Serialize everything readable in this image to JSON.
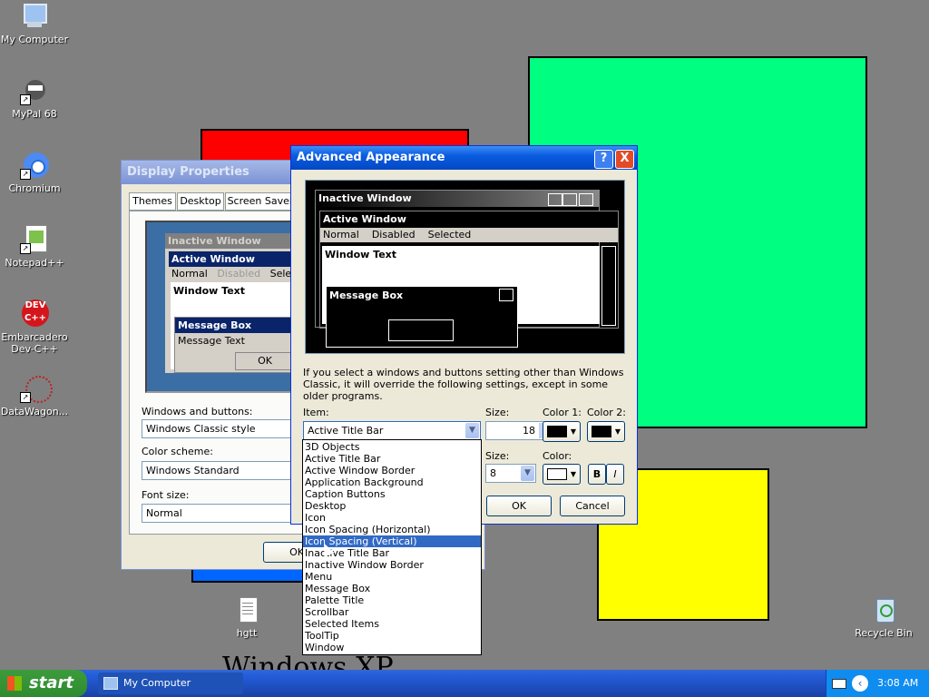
{
  "desktop": {
    "icons": [
      {
        "label": "My Computer",
        "icon": "computer-icon"
      },
      {
        "label": "MyPal 68",
        "icon": "raccoon-icon"
      },
      {
        "label": "Chromium",
        "icon": "chromium-icon"
      },
      {
        "label": "Notepad++",
        "icon": "notepad-icon"
      },
      {
        "label": "Embarcadero Dev-C++",
        "icon": "devcpp-icon"
      },
      {
        "label": "DataWagon...",
        "icon": "datawagon-icon"
      },
      {
        "label": "hgtt",
        "icon": "text-file-icon"
      },
      {
        "label": "Recycle Bin",
        "icon": "recycle-bin-icon"
      }
    ],
    "wallpaper_text": "Windows XP",
    "colors": {
      "background": "#808080",
      "green": "#00ff80",
      "red": "#ff0000",
      "blue": "#0066ff",
      "yellow": "#ffff00"
    }
  },
  "display_properties": {
    "title": "Display Properties",
    "tabs": [
      "Themes",
      "Desktop",
      "Screen Saver"
    ],
    "preview": {
      "inactive_title": "Inactive Window",
      "active_title": "Active Window",
      "menu": [
        "Normal",
        "Disabled",
        "Selected"
      ],
      "window_text": "Window Text",
      "msgbox_title": "Message Box",
      "msgbox_text": "Message Text",
      "ok": "OK"
    },
    "windows_buttons_label": "Windows and buttons:",
    "windows_buttons_value": "Windows Classic style",
    "color_scheme_label": "Color scheme:",
    "color_scheme_value": "Windows Standard",
    "font_size_label": "Font size:",
    "font_size_value": "Normal",
    "ok_button": "OK"
  },
  "advanced": {
    "title": "Advanced Appearance",
    "help": "?",
    "close": "X",
    "preview": {
      "inactive_title": "Inactive Window",
      "active_title": "Active Window",
      "menu": [
        "Normal",
        "Disabled",
        "Selected"
      ],
      "window_text": "Window Text",
      "msgbox_title": "Message Box"
    },
    "info_text": "If you select a windows and buttons setting other than Windows Classic, it will override the following settings, except in some older programs.",
    "item_label": "Item:",
    "item_value": "Active Title Bar",
    "size_label": "Size:",
    "size_value": "18",
    "color1_label": "Color 1:",
    "color2_label": "Color 2:",
    "font_size_label": "Size:",
    "font_size_value": "8",
    "font_color_label": "Color:",
    "bold": "B",
    "italic": "I",
    "ok": "OK",
    "cancel": "Cancel",
    "dropdown_items": [
      "3D Objects",
      "Active Title Bar",
      "Active Window Border",
      "Application Background",
      "Caption Buttons",
      "Desktop",
      "Icon",
      "Icon Spacing (Horizontal)",
      "Icon Spacing (Vertical)",
      "Inactive Title Bar",
      "Inactive Window Border",
      "Menu",
      "Message Box",
      "Palette Title",
      "Scrollbar",
      "Selected Items",
      "ToolTip",
      "Window"
    ],
    "selected_index": 8
  },
  "taskbar": {
    "start": "start",
    "task": "My Computer",
    "clock": "3:08 AM"
  }
}
